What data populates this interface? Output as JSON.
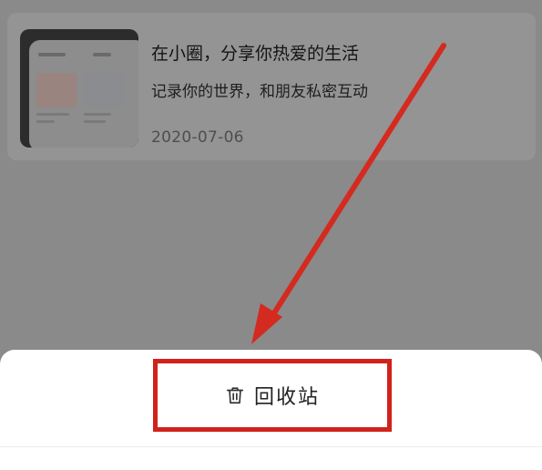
{
  "post_card": {
    "title": "在小圈，分享你热爱的生活",
    "subtitle": "记录你的世界，和朋友私密互动",
    "date": "2020-07-06"
  },
  "bottom_sheet": {
    "recycle_bin_label": "回收站",
    "recycle_bin_icon": "trash-icon"
  },
  "annotation": {
    "arrow_color": "#d42a1f",
    "highlight_color": "#d0221b"
  }
}
